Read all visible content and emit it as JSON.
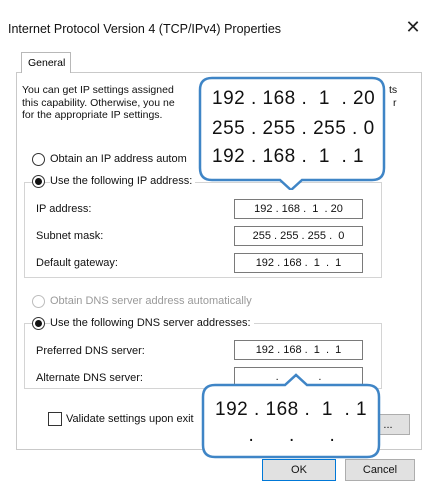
{
  "window": {
    "title": "Internet Protocol Version 4 (TCP/IPv4) Properties",
    "close_glyph": "✕"
  },
  "tabs": [
    {
      "label": "General",
      "selected": true
    }
  ],
  "description": {
    "line1": "You can get IP settings assigned",
    "line1_tail": "ts",
    "line2": "this capability. Otherwise, you ne",
    "line2_tail": "r",
    "line3": "for the appropriate IP settings."
  },
  "ip_section": {
    "auto_option": {
      "label": "Obtain an IP address autom",
      "selected": false
    },
    "manual_option": {
      "label": "Use the following IP address:",
      "selected": true
    },
    "fields": [
      {
        "label": "IP address:",
        "value": "192 . 168 .  1  . 20"
      },
      {
        "label": "Subnet mask:",
        "value": "255 . 255 . 255 .  0"
      },
      {
        "label": "Default gateway:",
        "value": "192 . 168 .  1  .  1"
      }
    ]
  },
  "dns_section": {
    "auto_option": {
      "label": "Obtain DNS server address automatically",
      "selected": false,
      "disabled": true
    },
    "manual_option": {
      "label": "Use the following DNS server addresses:",
      "selected": true
    },
    "fields": [
      {
        "label": "Preferred DNS server:",
        "value": "192 . 168 .  1  .  1"
      },
      {
        "label": "Alternate DNS server:",
        "value": "   .      .      .   "
      }
    ]
  },
  "validate": {
    "label": "Validate settings upon exit",
    "checked": false
  },
  "advanced_button": {
    "label": "..."
  },
  "buttons": {
    "ok": "OK",
    "cancel": "Cancel"
  },
  "callouts": {
    "ip": {
      "line1": "192 . 168 .  1  . 20",
      "line2": "255 . 255 . 255 . 0",
      "line3": "192 . 168 .  1  . 1"
    },
    "dns": {
      "line1": "192 . 168 .  1  . 1",
      "line2": "  .      .      .  "
    }
  },
  "colors": {
    "callout_border": "#3f85c6",
    "default_button_border": "#0078d7"
  }
}
